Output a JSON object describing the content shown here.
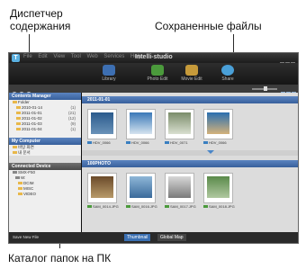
{
  "callouts": {
    "top_left": "Диспетчер\nсодержания",
    "top_right": "Сохраненные файлы",
    "bottom": "Каталог папок на ПК"
  },
  "app": {
    "brand": "Intelli-studio",
    "menus": "File Edit View Tool Web Services Help",
    "toolbar": [
      {
        "label": "Library",
        "icon": "library-icon",
        "color": "#3d6fb2"
      },
      {
        "label": "Photo Edit",
        "icon": "photo-edit-icon",
        "color": "#4b9a3c"
      },
      {
        "label": "Movie Edit",
        "icon": "movie-edit-icon",
        "color": "#c69a3a"
      },
      {
        "label": "Share",
        "icon": "share-icon",
        "color": "#4aa0d8"
      }
    ]
  },
  "sidebar": {
    "contents_manager": "Contents Manager",
    "folder_label": "Folder",
    "folders": [
      {
        "name": "2010-01-14",
        "count": "(1)"
      },
      {
        "name": "2011-01-01",
        "count": "(21)"
      },
      {
        "name": "2011-01-02",
        "count": "(12)"
      },
      {
        "name": "2011-01-03",
        "count": "(9)"
      },
      {
        "name": "2011-01-04",
        "count": "(1)"
      }
    ],
    "my_computer": "My Computer",
    "pc_items": [
      "바탕 화면",
      "내 문서"
    ],
    "connected_device": "Connected Device",
    "device_items": [
      "SMX-F50",
      "W:",
      "DCIM",
      "MISC",
      "VIDEO"
    ],
    "save_new_file": "Save New File"
  },
  "main": {
    "group1_title": "2011-01-01",
    "group1_items": [
      "HDV_0066",
      "HDV_0066",
      "HDV_0071",
      "HDV_0066"
    ],
    "group2_title": "100PHOTO",
    "group2_items": [
      "SAM_0014.JPG",
      "SAM_0016.JPG",
      "SAM_0017.JPG",
      "SAM_0018.JPG"
    ]
  },
  "bottom_tabs": [
    "Thumbnail",
    "Global Map"
  ]
}
